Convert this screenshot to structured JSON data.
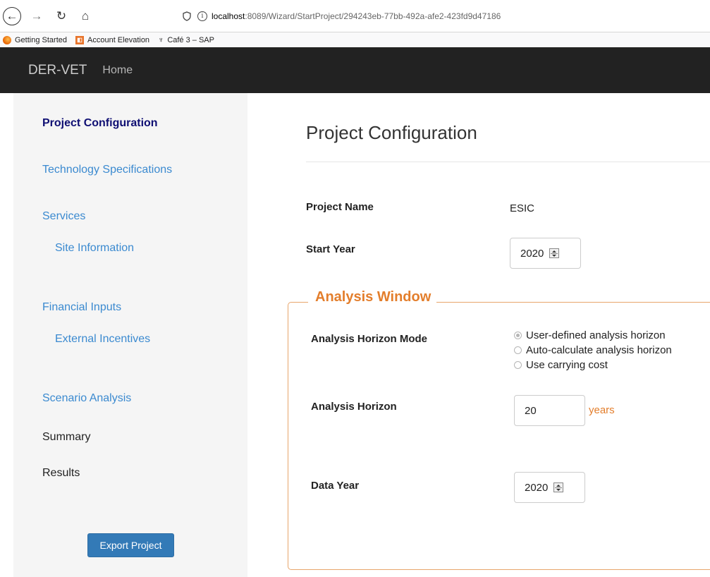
{
  "browser": {
    "url_host": "localhost",
    "url_rest": ":8089/Wizard/StartProject/294243eb-77bb-492a-afe2-423fd9d47186",
    "bookmarks": [
      "Getting Started",
      "Account Elevation",
      "Café 3 – SAP"
    ]
  },
  "navbar": {
    "brand": "DER-VET",
    "home": "Home"
  },
  "sidebar": {
    "items": [
      {
        "label": "Project Configuration"
      },
      {
        "label": "Technology Specifications"
      },
      {
        "label": "Services"
      },
      {
        "label": "Site Information"
      },
      {
        "label": "Financial Inputs"
      },
      {
        "label": "External Incentives"
      },
      {
        "label": "Scenario Analysis"
      },
      {
        "label": "Summary"
      },
      {
        "label": "Results"
      }
    ],
    "export_label": "Export Project"
  },
  "main": {
    "title": "Project Configuration",
    "project_name_label": "Project Name",
    "project_name_value": "ESIC",
    "start_year_label": "Start Year",
    "start_year_value": "2020",
    "analysis_window": {
      "legend": "Analysis Window",
      "horizon_mode_label": "Analysis Horizon Mode",
      "horizon_mode_options": [
        {
          "label": "User-defined analysis horizon",
          "selected": true
        },
        {
          "label": "Auto-calculate analysis horizon",
          "selected": false
        },
        {
          "label": "Use carrying cost",
          "selected": false
        }
      ],
      "horizon_label": "Analysis Horizon",
      "horizon_value": "20",
      "horizon_unit": "years",
      "data_year_label": "Data Year",
      "data_year_value": "2020"
    }
  },
  "colors": {
    "accent_orange": "#e37e2c",
    "link_blue": "#3b8ad0",
    "active_nav": "#0f0f73",
    "navbar_bg": "#222222"
  }
}
